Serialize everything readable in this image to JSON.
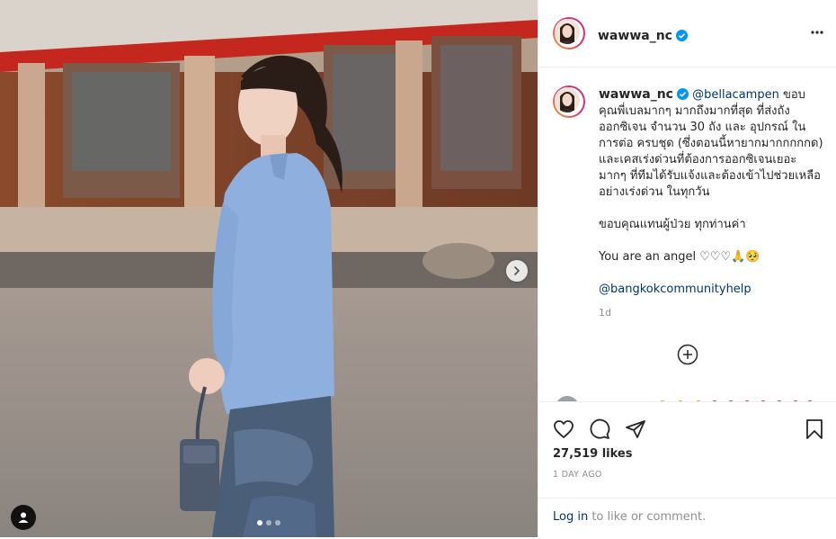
{
  "post": {
    "username": "wawwa_nc",
    "caption_mention": "@bellacampen",
    "caption_text": " ขอบคุณพี่เบลมากๆ มากถึงมากที่สุด ที่ส่งถังออกซิเจน จำนวน 30 ถัง และ อุปกรณ์ ในการต่อ ครบชุด (ซึ่งตอนนี้หายากมากกกกกด) และเคสเร่งด่วนที่ต้องการออกซิเจนเยอะมากๆ ที่ทีมได้รับแจ้งและต้องเข้าไปช่วยเหลืออย่างเร่งด่วน ในทุกวัน",
    "caption_thanks": "ขอบคุณแทนผู้ป่วย ทุกท่านค่า",
    "caption_angel": "You are an angel ♡♡♡🙏🥺",
    "caption_tag": "@bangkokcommunityhelp",
    "caption_time": "1d",
    "likes": "27,519 likes",
    "date": "1 DAY AGO",
    "login_link": "Log in",
    "login_rest": " to like or comment."
  },
  "icons": {
    "verified": "verified-badge-icon",
    "more": "more-options-icon",
    "next": "chevron-right-icon",
    "tag": "user-tag-icon",
    "add_comment": "plus-circle-icon",
    "like": "heart-icon",
    "comment": "comment-icon",
    "share": "send-icon",
    "save": "bookmark-icon"
  },
  "carousel": {
    "slides": 3,
    "active": 0
  },
  "colors": {
    "verified": "#0095f6",
    "link": "#00376b",
    "muted": "#8e8e8e"
  }
}
